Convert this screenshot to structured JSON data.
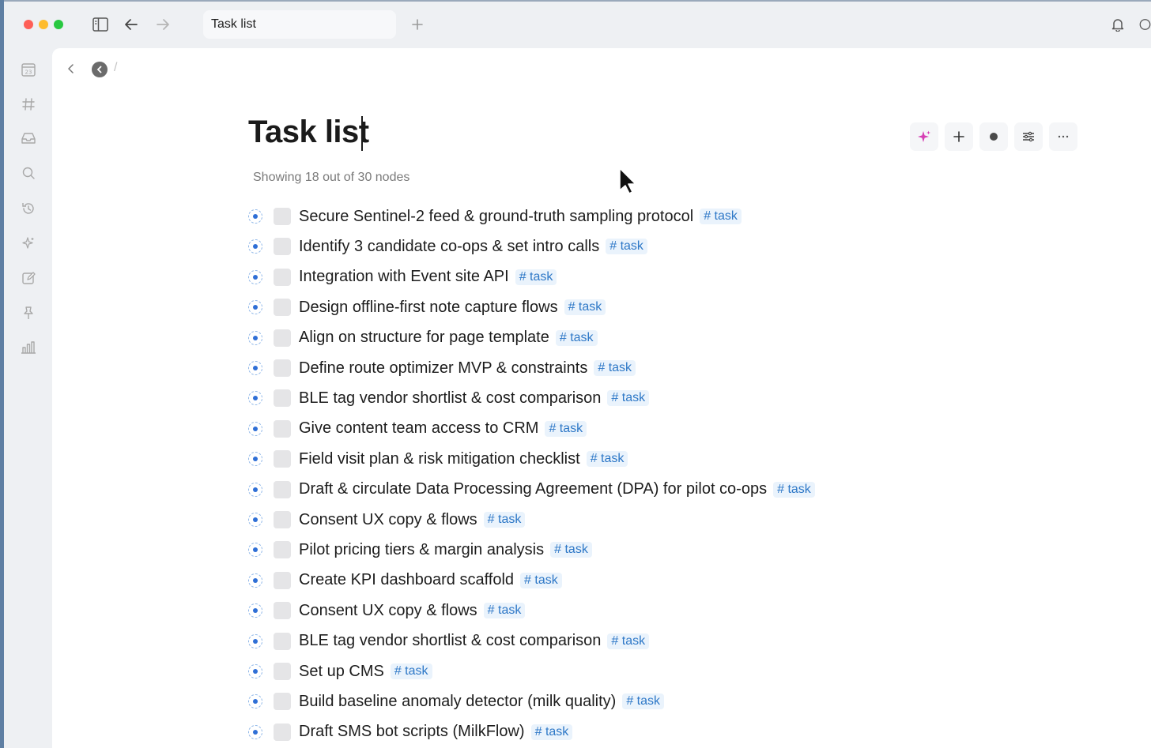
{
  "window": {
    "tab_title": "Task list",
    "colors": {
      "accent": "#2f6fd6",
      "tag_bg": "#eaf3fc",
      "tag_text": "#2e78c7"
    }
  },
  "titlebar": {
    "icons": [
      "sidebar-toggle-icon",
      "back-arrow-icon",
      "forward-arrow-icon",
      "plus-icon",
      "bell-icon"
    ]
  },
  "rail": {
    "icons": [
      "calendar-icon",
      "hashtag-icon",
      "inbox-icon",
      "search-icon",
      "history-icon",
      "sparkle-icon",
      "edit-icon",
      "pin-icon",
      "chart-icon"
    ]
  },
  "breadcrumb": {
    "separator": "/"
  },
  "page": {
    "title": "Task list",
    "count_text": "Showing 18 out of 30 nodes"
  },
  "toolbar": {
    "icons": [
      "ai-sparkle-icon",
      "add-icon",
      "record-icon",
      "filter-icon",
      "more-icon"
    ]
  },
  "tasks": [
    {
      "text": "Secure Sentinel-2 feed & ground-truth sampling protocol",
      "tag": "# task"
    },
    {
      "text": "Identify 3 candidate co-ops & set intro calls",
      "tag": "# task"
    },
    {
      "text": "Integration with Event site API",
      "tag": "# task"
    },
    {
      "text": "Design offline-first note capture flows",
      "tag": "# task"
    },
    {
      "text": "Align on structure for page template",
      "tag": "# task"
    },
    {
      "text": "Define route optimizer MVP & constraints",
      "tag": "# task"
    },
    {
      "text": "BLE tag vendor shortlist & cost comparison",
      "tag": "# task"
    },
    {
      "text": "Give content team access to CRM",
      "tag": "# task"
    },
    {
      "text": "Field visit plan & risk mitigation checklist",
      "tag": "# task"
    },
    {
      "text": "Draft & circulate Data Processing Agreement (DPA) for pilot co-ops",
      "tag": "# task"
    },
    {
      "text": "Consent UX copy & flows",
      "tag": "# task"
    },
    {
      "text": "Pilot pricing tiers & margin analysis",
      "tag": "# task"
    },
    {
      "text": "Create KPI dashboard scaffold",
      "tag": "# task"
    },
    {
      "text": "Consent UX copy & flows",
      "tag": "# task"
    },
    {
      "text": "BLE tag vendor shortlist & cost comparison",
      "tag": "# task"
    },
    {
      "text": "Set up CMS",
      "tag": "# task"
    },
    {
      "text": "Build baseline anomaly detector (milk quality)",
      "tag": "# task"
    },
    {
      "text": "Draft SMS bot scripts (MilkFlow)",
      "tag": "# task"
    }
  ]
}
